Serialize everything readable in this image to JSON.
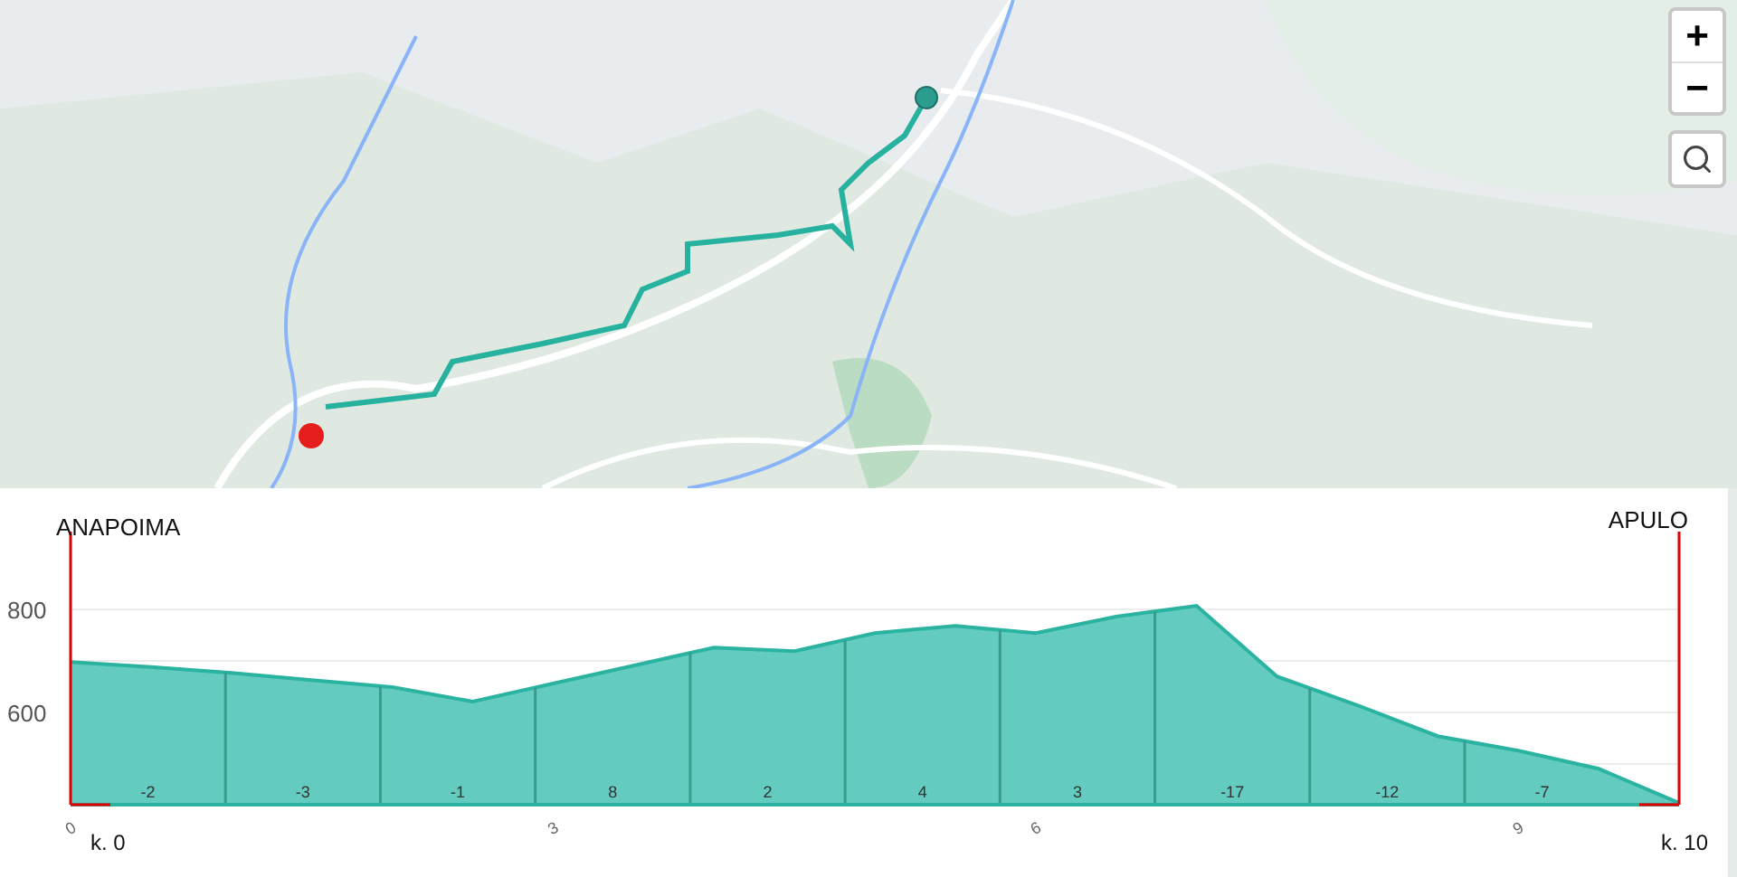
{
  "map": {
    "controls": [
      {
        "kind": "zoom-in",
        "label": "+"
      },
      {
        "kind": "zoom-out",
        "label": "−"
      },
      {
        "kind": "search"
      }
    ]
  },
  "profile": {
    "start_label": "ANAPOIMA",
    "end_label": "APULO",
    "start_km": "k. 0",
    "end_km": "k. 10",
    "segments": [
      {
        "grade": "-2"
      },
      {
        "grade": "-3"
      },
      {
        "grade": "-1"
      },
      {
        "grade": "8"
      },
      {
        "grade": "2"
      },
      {
        "grade": "4"
      },
      {
        "grade": "3"
      },
      {
        "grade": "-17"
      },
      {
        "grade": "-12"
      },
      {
        "grade": "-7"
      }
    ],
    "chart_data": {
      "type": "area",
      "x": [
        0,
        0.5,
        1,
        1.5,
        2,
        2.5,
        3,
        3.5,
        4,
        4.5,
        5,
        5.5,
        6,
        6.5,
        7,
        7.5,
        8,
        8.5,
        9,
        9.5,
        10
      ],
      "series": [
        {
          "color": "#63cbbf",
          "values": [
            698,
            688,
            677,
            663,
            649,
            621,
            656,
            691,
            726,
            719,
            754,
            768,
            754,
            786,
            807,
            670,
            614,
            554,
            526,
            491,
            424
          ]
        }
      ],
      "xlim": [
        0,
        10
      ],
      "ref_lines": [
        {
          "axis": "x",
          "value": 0.963
        },
        {
          "axis": "x",
          "value": 1.926
        },
        {
          "axis": "x",
          "value": 2.889
        },
        {
          "axis": "x",
          "value": 3.852
        },
        {
          "axis": "x",
          "value": 4.815
        },
        {
          "axis": "x",
          "value": 5.778
        },
        {
          "axis": "x",
          "value": 6.741
        },
        {
          "axis": "x",
          "value": 7.704
        },
        {
          "axis": "x",
          "value": 8.667
        }
      ],
      "ylim": [
        421,
        951
      ],
      "xticks": [
        0,
        3,
        6,
        9
      ],
      "yticks": [
        600,
        800
      ]
    }
  }
}
